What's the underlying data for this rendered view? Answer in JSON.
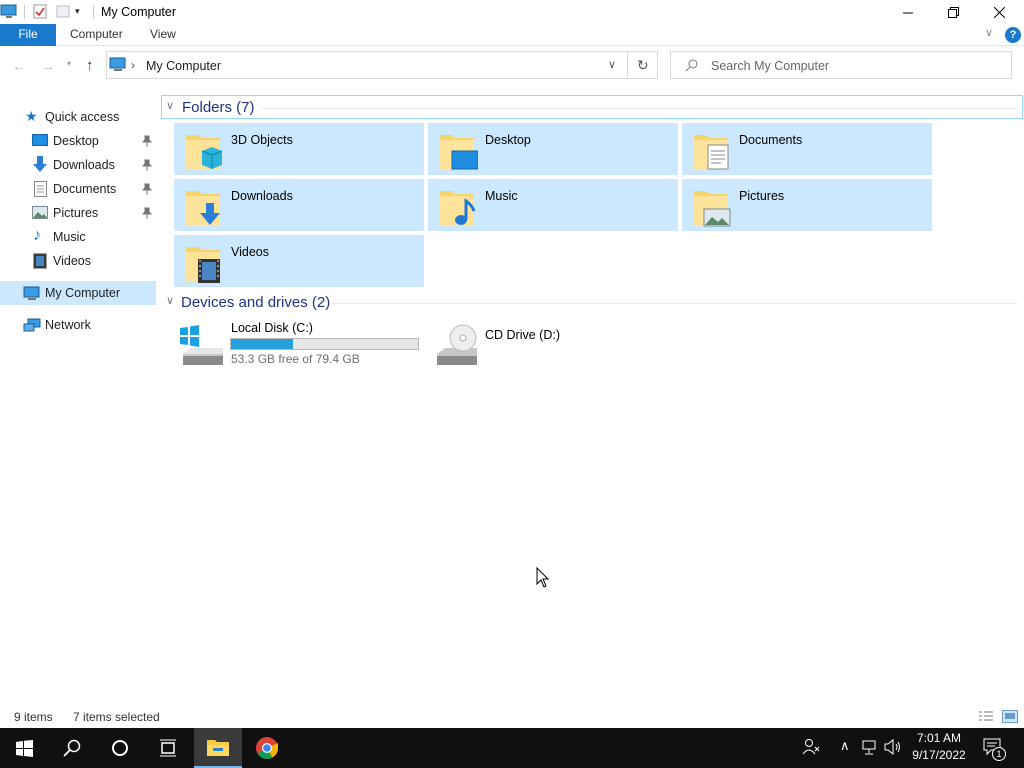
{
  "window": {
    "title": "My Computer"
  },
  "ribbon": {
    "tabs": [
      "File",
      "Computer",
      "View"
    ]
  },
  "address": {
    "path": "My Computer",
    "separator": "›"
  },
  "search": {
    "placeholder": "Search My Computer"
  },
  "nav": {
    "quick_access": "Quick access",
    "items": [
      {
        "label": "Desktop",
        "icon": "desktop-icon",
        "pinned": true
      },
      {
        "label": "Downloads",
        "icon": "downloads-icon",
        "pinned": true
      },
      {
        "label": "Documents",
        "icon": "documents-icon",
        "pinned": true
      },
      {
        "label": "Pictures",
        "icon": "pictures-icon",
        "pinned": true
      },
      {
        "label": "Music",
        "icon": "music-icon",
        "pinned": false
      },
      {
        "label": "Videos",
        "icon": "videos-icon",
        "pinned": false
      }
    ],
    "my_computer": "My Computer",
    "network": "Network"
  },
  "folders": {
    "header": "Folders (7)",
    "items": [
      "3D Objects",
      "Desktop",
      "Documents",
      "Downloads",
      "Music",
      "Pictures",
      "Videos"
    ]
  },
  "drives": {
    "header": "Devices and drives (2)",
    "c": {
      "name": "Local Disk (C:)",
      "free_text": "53.3 GB free of 79.4 GB",
      "used_fraction": 0.329
    },
    "d": {
      "name": "CD Drive (D:)"
    }
  },
  "status": {
    "count": "9 items",
    "selected": "7 items selected"
  },
  "taskbar": {
    "time": "7:01 AM",
    "date": "9/17/2022",
    "notifications": "1"
  },
  "colors": {
    "accent": "#1979ca",
    "selection": "#cce8ff",
    "progress": "#26a0da",
    "header_text": "#1e3287"
  }
}
